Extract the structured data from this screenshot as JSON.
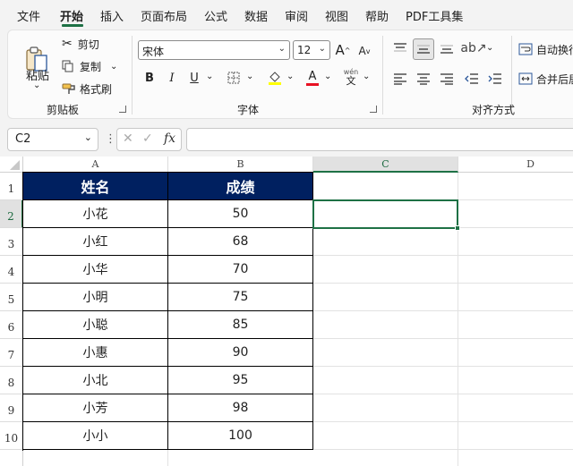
{
  "menu": [
    "文件",
    "开始",
    "插入",
    "页面布局",
    "公式",
    "数据",
    "审阅",
    "视图",
    "帮助",
    "PDF工具集"
  ],
  "ribbon": {
    "paste": "粘贴",
    "cut": "剪切",
    "copy": "复制",
    "format_painter": "格式刷",
    "clipboard_group": "剪贴板",
    "font_name": "宋体",
    "font_size": "12",
    "bold": "B",
    "italic": "I",
    "underline": "U",
    "font_group": "字体",
    "wrap_text": "自动换行",
    "merge_center": "合并后居中",
    "align_group": "对齐方式",
    "wen": "wén",
    "wen_char": "文"
  },
  "formula_bar": {
    "name_box": "C2",
    "fx": "fx",
    "formula": ""
  },
  "columns": [
    "A",
    "B",
    "C",
    "D"
  ],
  "rows": [
    "1",
    "2",
    "3",
    "4",
    "5",
    "6",
    "7",
    "8",
    "9",
    "10"
  ],
  "table": {
    "headers": [
      "姓名",
      "成绩"
    ],
    "rows": [
      [
        "小花",
        "50"
      ],
      [
        "小红",
        "68"
      ],
      [
        "小华",
        "70"
      ],
      [
        "小明",
        "75"
      ],
      [
        "小聪",
        "85"
      ],
      [
        "小惠",
        "90"
      ],
      [
        "小北",
        "95"
      ],
      [
        "小芳",
        "98"
      ],
      [
        "小小",
        "100"
      ]
    ]
  },
  "colors": {
    "header_fill": "#002060",
    "accent": "#1e7145",
    "font_red": "#e81123",
    "highlight_yellow": "#ffff00"
  }
}
